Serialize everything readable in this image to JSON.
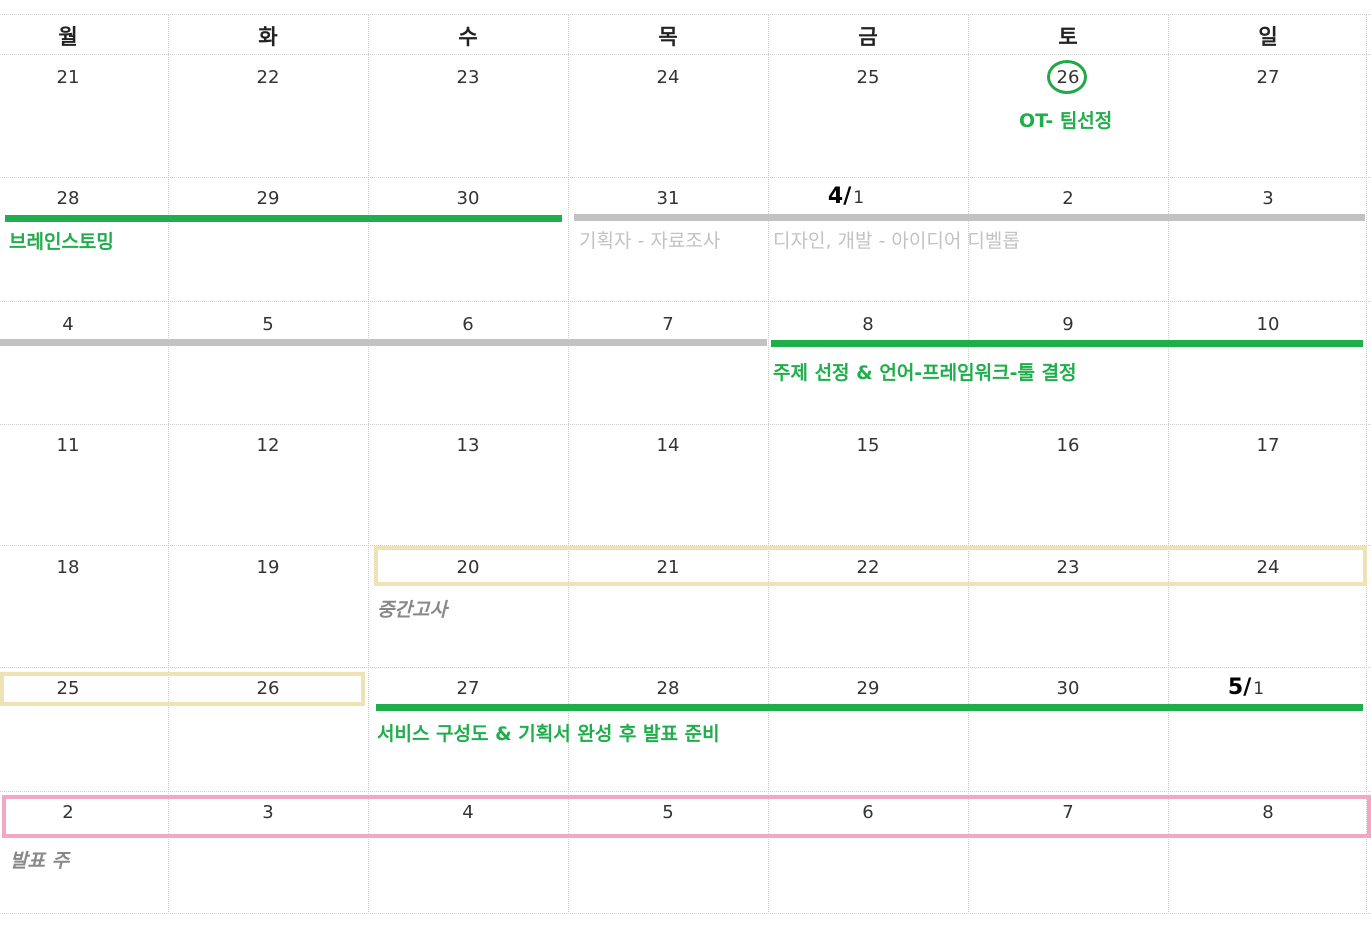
{
  "weekdays": [
    "월",
    "화",
    "수",
    "목",
    "금",
    "토",
    "일"
  ],
  "weeks": [
    [
      "21",
      "22",
      "23",
      "24",
      "25",
      "26",
      "27"
    ],
    [
      "28",
      "29",
      "30",
      "31",
      "1",
      "2",
      "3"
    ],
    [
      "4",
      "5",
      "6",
      "7",
      "8",
      "9",
      "10"
    ],
    [
      "11",
      "12",
      "13",
      "14",
      "15",
      "16",
      "17"
    ],
    [
      "18",
      "19",
      "20",
      "21",
      "22",
      "23",
      "24"
    ],
    [
      "25",
      "26",
      "27",
      "28",
      "29",
      "30",
      "1"
    ],
    [
      "2",
      "3",
      "4",
      "5",
      "6",
      "7",
      "8"
    ]
  ],
  "month_markers": {
    "april": {
      "month": "4/",
      "day": "1"
    },
    "may": {
      "month": "5/",
      "day": "1"
    }
  },
  "events": {
    "ot": "OT- 팀선정",
    "brainstorm": "브레인스토밍",
    "planner_research": "기획자 - 자료조사",
    "design_dev": "디자인, 개발 - 아이디어 디벨롭",
    "topic": "주제 선정 & 언어-프레임워크-툴 결정",
    "midterm": "중간고사",
    "service": "서비스 구성도 & 기획서 완성 후 발표 준비",
    "presentation": "발표 주"
  },
  "colors": {
    "green": "#1fae4b",
    "gray_bar": "#c2c2c2",
    "midterm_box": "#efe3b5",
    "presentation_box": "#f4a7c4"
  }
}
